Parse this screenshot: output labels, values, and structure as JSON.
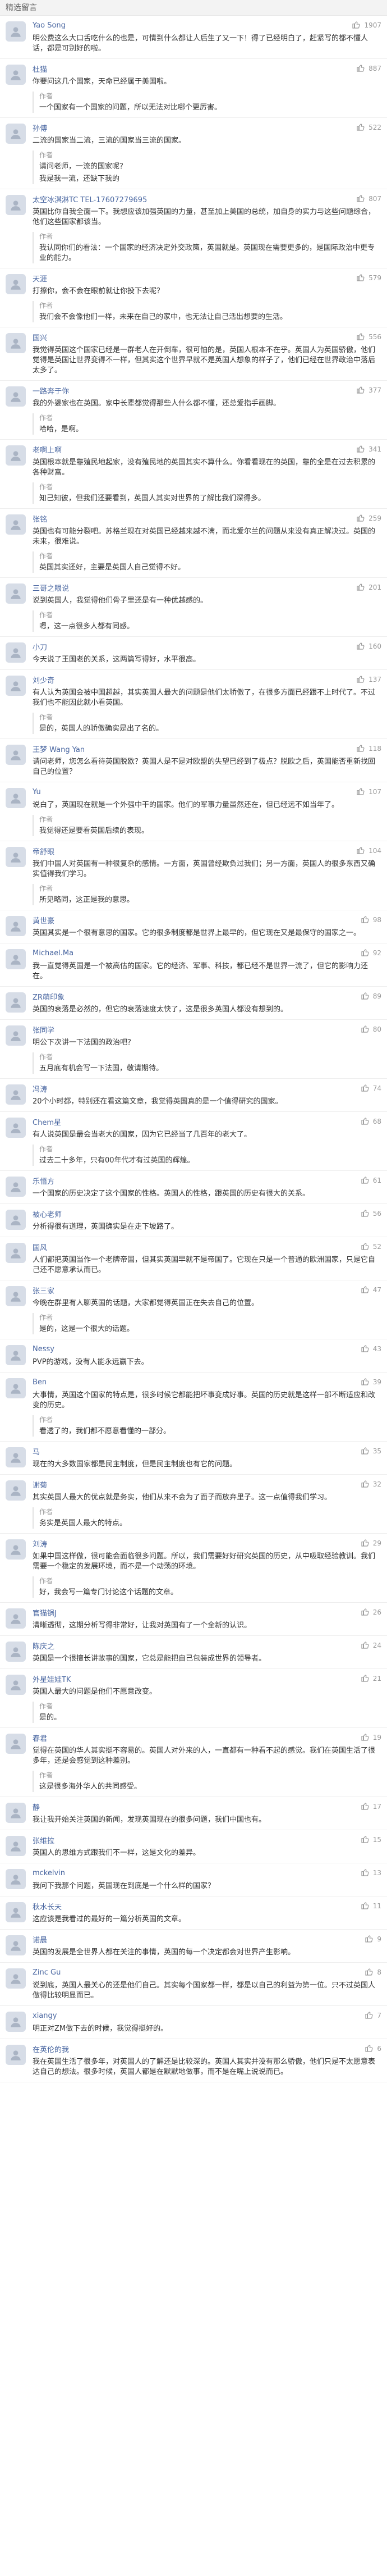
{
  "topbar": {
    "title": "精选留言"
  },
  "comments": [
    {
      "name": "Yao Song",
      "likes": "1907",
      "text": "明公费这么大口舌吃什么的也是，可情到什么都让人后生了又一下！得了已经明白了，赶紧写的都不懂人话，都是可别好的啦。"
    },
    {
      "name": "杜猫",
      "likes": "887",
      "text": "你要问这几个国家，天命已经属于美国啦。",
      "reply_label": "作者",
      "reply_text": "一个国家有一个国家的问题，所以无法对比哪个更厉害。"
    },
    {
      "name": "孙傅",
      "likes": "522",
      "text": "二流的国家当二流，三流的国家当三流的国家。",
      "reply_label": "作者",
      "reply_text": "请问老师，一流的国家呢？",
      "reply_text_2": "我是我一流，还缺下我的"
    },
    {
      "name": "太空冰淇淋TC TEL-17607279695",
      "likes": "807",
      "text": "英国比你自我全面一下。我想应该加强英国的力量，甚至加上美国的总统，加自身的实力与这些问题综合，他们这些国家都该当。",
      "reply_label": "作者",
      "reply_text": "我认同你们的看法：一个国家的经济决定外交政策，英国就是。英国现在需要更多的，是国际政治中更专业的能力。"
    },
    {
      "name": "天涯",
      "likes": "579",
      "text": "打擦你，会不会在眼前就让你投下去呢？",
      "reply_label": "作者",
      "reply_text": "我们会不会像他们一样，未来在自己的家中，也无法让自己活出想要的生活。"
    },
    {
      "name": "国兴",
      "likes": "556",
      "text": "我觉得英国这个国家已经是一群老人在开倒车，很可怕的是，英国人根本不在乎。英国人为英国骄傲，他们觉得是英国让世界变得不一样，但其实这个世界早就不是英国人想象的样子了，他们已经在世界政治中落后太多了。"
    },
    {
      "name": "一路奔于你",
      "likes": "377",
      "text": "我的外婆家也在英国。家中长辈都觉得那些人什么都不懂，还总爱指手画脚。",
      "reply_label": "作者",
      "reply_text": "哈哈，是啊。"
    },
    {
      "name": "老啊上啊",
      "likes": "341",
      "text": "英国根本就是靠殖民地起家，没有殖民地的英国其实不算什么。你看看现在的英国，靠的全是在过去积累的各种财富。",
      "reply_label": "作者",
      "reply_text": "知己知彼，但我们还要看到，英国人其实对世界的了解比我们深得多。"
    },
    {
      "name": "张铭",
      "likes": "259",
      "text": "英国也有可能分裂吧。苏格兰现在对英国已经越来越不满，而北爱尔兰的问题从来没有真正解决过。英国的未来，很难说。",
      "reply_label": "作者",
      "reply_text": "英国其实还好，主要是英国人自己觉得不好。"
    },
    {
      "name": "三哥之眼说",
      "likes": "201",
      "text": "说到英国人，我觉得他们骨子里还是有一种优越感的。",
      "reply_label": "作者",
      "reply_text": "嗯，这一点很多人都有同感。"
    },
    {
      "name": "小刀",
      "likes": "160",
      "text": "今天说了王国老的关系，这两篇写得好，水平很高。"
    },
    {
      "name": "刘少奇",
      "likes": "137",
      "text": "有人认为英国会被中国超越，其实英国人最大的问题是他们太骄傲了，在很多方面已经跟不上时代了。不过我们也不能因此就小看英国。",
      "reply_label": "作者",
      "reply_text": "是的，英国人的骄傲确实是出了名的。"
    },
    {
      "name": "王梦 Wang Yan",
      "likes": "118",
      "text": "请问老师，您怎么看待英国脱欧？英国人是不是对欧盟的失望已经到了极点？脱欧之后，英国能否重新找回自己的位置？"
    },
    {
      "name": "Yu",
      "likes": "107",
      "text": "说白了，英国现在就是一个外强中干的国家。他们的军事力量虽然还在，但已经远不如当年了。",
      "reply_label": "作者",
      "reply_text": "我觉得还是要看英国后续的表现。"
    },
    {
      "name": "帝舒眼",
      "likes": "104",
      "text": "我们中国人对英国有一种很复杂的感情。一方面，英国曾经欺负过我们；另一方面，英国人的很多东西又确实值得我们学习。",
      "reply_label": "作者",
      "reply_text": "所见略同，这正是我的意思。"
    },
    {
      "name": "黄世豪",
      "likes": "98",
      "text": "英国其实是一个很有意思的国家。它的很多制度都是世界上最早的，但它现在又是最保守的国家之一。"
    },
    {
      "name": "Michael.Ma",
      "likes": "92",
      "text": "我一直觉得英国是一个被高估的国家。它的经济、军事、科技，都已经不是世界一流了，但它的影响力还在。"
    },
    {
      "name": "ZR萌印象",
      "likes": "89",
      "text": "英国的衰落是必然的，但它的衰落速度太快了，这是很多英国人都没有想到的。"
    },
    {
      "name": "张同学",
      "likes": "80",
      "text": "明公下次讲一下法国的政治吧？",
      "reply_label": "作者",
      "reply_text": "五月底有机会写一下法国，敬请期待。"
    },
    {
      "name": "冯涛",
      "likes": "74",
      "text": "20个小时都，特别还在看这篇文章，我觉得英国真的是一个值得研究的国家。"
    },
    {
      "name": "Chem星",
      "likes": "68",
      "text": "有人说英国是最会当老大的国家，因为它已经当了几百年的老大了。",
      "reply_label": "作者",
      "reply_text": "过去二十多年，只有00年代才有过英国的辉煌。"
    },
    {
      "name": "乐悟方",
      "likes": "61",
      "text": "一个国家的历史决定了这个国家的性格。英国人的性格，跟英国的历史有很大的关系。"
    },
    {
      "name": "被心老师",
      "likes": "56",
      "text": "分析得很有道理，英国确实是在走下坡路了。"
    },
    {
      "name": "国风",
      "likes": "52",
      "text": "人们都把英国当作一个老牌帝国，但其实英国早就不是帝国了。它现在只是一个普通的欧洲国家，只是它自己还不愿意承认而已。"
    },
    {
      "name": "张三家",
      "likes": "47",
      "text": "今晚在群里有人聊英国的话题，大家都觉得英国正在失去自己的位置。",
      "reply_label": "作者",
      "reply_text": "是的，这是一个很大的话题。"
    },
    {
      "name": "Nessy",
      "likes": "43",
      "text": "PVP的游戏，没有人能永远赢下去。"
    },
    {
      "name": "Ben",
      "likes": "39",
      "text": "大事情，英国这个国家的特点是，很多时候它都能把坏事变成好事。英国的历史就是这样一部不断适应和改变的历史。",
      "reply_label": "作者",
      "reply_text": "看透了的，我们都不愿意看懂的一部分。"
    },
    {
      "name": "马",
      "likes": "35",
      "text": "现在的大多数国家都是民主制度，但是民主制度也有它的问题。"
    },
    {
      "name": "谢菊",
      "likes": "32",
      "text": "其实英国人最大的优点就是务实，他们从来不会为了面子而放弃里子。这一点值得我们学习。",
      "reply_label": "作者",
      "reply_text": "务实是英国人最大的特点。"
    },
    {
      "name": "刘涛",
      "likes": "29",
      "text": "如果中国这样做，很可能会面临很多问题。所以，我们需要好好研究英国的历史，从中吸取经验教训。我们需要一个稳定的发展环境，而不是一个动荡的环境。",
      "reply_label": "作者",
      "reply_text": "好，我会写一篇专门讨论这个话题的文章。"
    },
    {
      "name": "官猫锅J",
      "likes": "26",
      "text": "清晰透彻，这期分析写得非常好，让我对英国有了一个全新的认识。"
    },
    {
      "name": "陈庆之",
      "likes": "24",
      "text": "英国是一个很擅长讲故事的国家，它总是能把自己包装成世界的领导者。"
    },
    {
      "name": "外星娃娃TK",
      "likes": "21",
      "text": "英国人最大的问题是他们不愿意改变。",
      "reply_label": "作者",
      "reply_text": "是的。"
    },
    {
      "name": "春君",
      "likes": "19",
      "text": "觉得在英国的华人其实挺不容易的。英国人对外来的人，一直都有一种看不起的感觉。我们在英国生活了很多年，还是会感觉到这种差别。",
      "reply_label": "作者",
      "reply_text": "这是很多海外华人的共同感受。"
    },
    {
      "name": "静",
      "likes": "17",
      "text": "我让我开始关注英国的新闻，发现英国现在的很多问题，我们中国也有。"
    },
    {
      "name": "张维拉",
      "likes": "15",
      "text": "英国人的思维方式跟我们不一样，这是文化的差异。"
    },
    {
      "name": "mckelvin",
      "likes": "13",
      "text": "我问下我那个问题，英国现在到底是一个什么样的国家？"
    },
    {
      "name": "秋水长天",
      "likes": "11",
      "text": "这应该是我看过的最好的一篇分析英国的文章。"
    },
    {
      "name": "诺晨",
      "likes": "9",
      "text": "英国的发展是全世界人都在关注的事情，英国的每一个决定都会对世界产生影响。"
    },
    {
      "name": "Zinc Gu",
      "likes": "8",
      "text": "说到底，英国人最关心的还是他们自己。其实每个国家都一样，都是以自己的利益为第一位。只不过英国人做得比较明显而已。"
    },
    {
      "name": "xiangy",
      "likes": "7",
      "text": "明正对ZM做下去的时候，我觉得挺好的。"
    },
    {
      "name": "在英伦的我",
      "likes": "6",
      "text": "我在英国生活了很多年，对英国人的了解还是比较深的。英国人其实并没有那么骄傲，他们只是不太愿意表达自己的想法。很多时候，英国人都是在默默地做事，而不是在嘴上说说而已。"
    }
  ]
}
